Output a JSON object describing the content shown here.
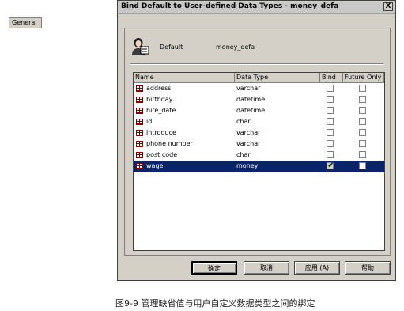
{
  "window": {
    "title": "Bind Default to User-defined Data Types - money_defa",
    "close_glyph": "X"
  },
  "tab": {
    "label": "General"
  },
  "default_info": {
    "icon": "person-with-document-icon",
    "label": "Default",
    "value": "money_defa"
  },
  "grid": {
    "columns": [
      "Name",
      "Data Type",
      "Bind",
      "Future Only"
    ],
    "rows": [
      {
        "name": "address",
        "data_type": "varchar",
        "bind": false,
        "future_only": false,
        "selected": false
      },
      {
        "name": "birthday",
        "data_type": "datetime",
        "bind": false,
        "future_only": false,
        "selected": false
      },
      {
        "name": "hire_date",
        "data_type": "datetime",
        "bind": false,
        "future_only": false,
        "selected": false
      },
      {
        "name": "id",
        "data_type": "char",
        "bind": false,
        "future_only": false,
        "selected": false
      },
      {
        "name": "introduce",
        "data_type": "varchar",
        "bind": false,
        "future_only": false,
        "selected": false
      },
      {
        "name": "phone number",
        "data_type": "varchar",
        "bind": false,
        "future_only": false,
        "selected": false
      },
      {
        "name": "post code",
        "data_type": "char",
        "bind": false,
        "future_only": false,
        "selected": false
      },
      {
        "name": "wage",
        "data_type": "money",
        "bind": true,
        "future_only": false,
        "selected": true
      }
    ]
  },
  "buttons": {
    "ok": "确定",
    "cancel": "取消",
    "apply": "应用 (A)",
    "help": "帮助"
  },
  "caption": "图9-9  管理缺省值与用户自定义数据类型之间的绑定"
}
